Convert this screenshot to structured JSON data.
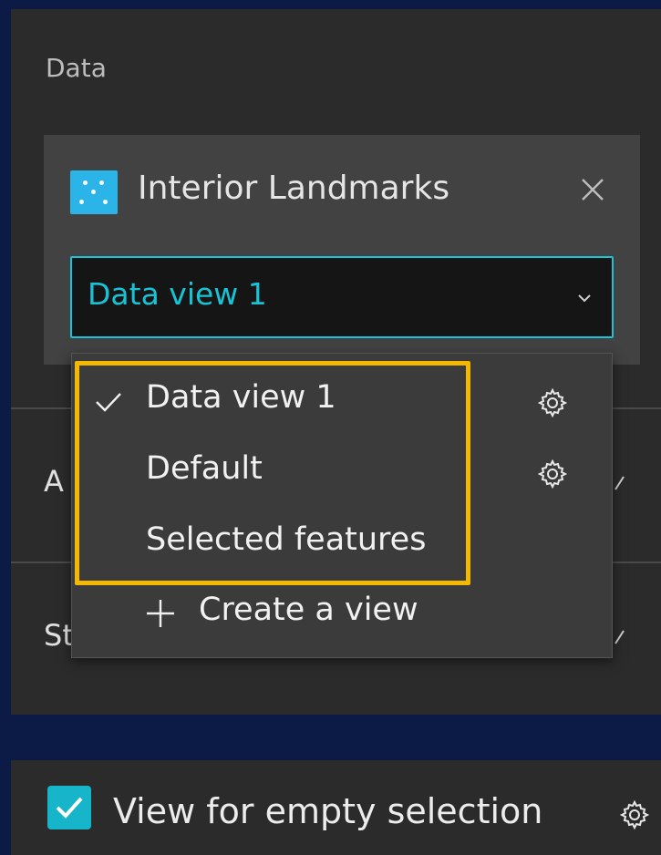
{
  "data_section": {
    "title": "Data",
    "source": {
      "name": "Interior Landmarks",
      "icon": "point-layer-icon",
      "close_icon": "close-icon"
    },
    "view_select": {
      "value": "Data view 1",
      "accent_color": "#17c3d4"
    }
  },
  "hidden_rows": [
    {
      "label": "A"
    },
    {
      "label": "St"
    }
  ],
  "view_menu": {
    "items": [
      {
        "label": "Data view 1",
        "selected": true,
        "has_settings": true
      },
      {
        "label": "Default",
        "selected": false,
        "has_settings": true
      },
      {
        "label": "Selected features",
        "selected": false,
        "has_settings": false
      }
    ],
    "create_label": "Create a view",
    "highlight_color": "#f5b800"
  },
  "empty_selection": {
    "label": "View for empty selection",
    "checked": true
  }
}
